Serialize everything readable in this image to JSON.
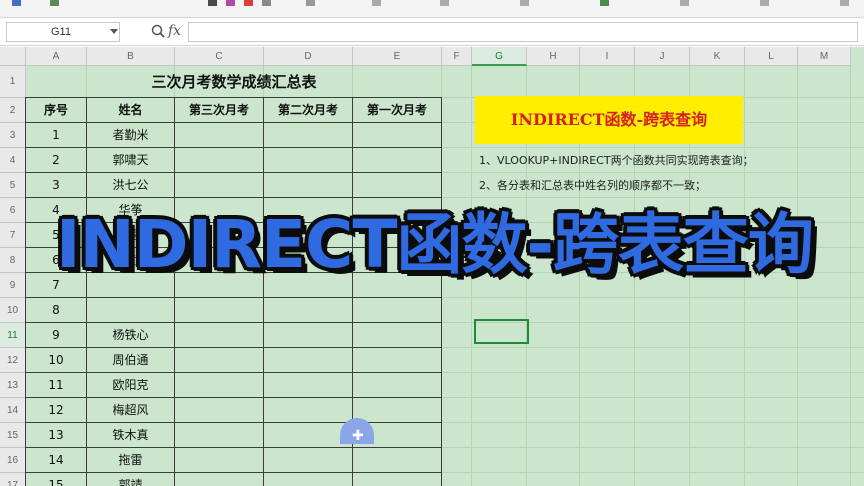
{
  "formula_bar": {
    "name_box": "G11",
    "fx_label": "fx",
    "formula": ""
  },
  "columns": [
    "A",
    "B",
    "C",
    "D",
    "E",
    "F",
    "G",
    "H",
    "I",
    "J",
    "K",
    "L",
    "M"
  ],
  "rows": [
    "1",
    "2",
    "3",
    "4",
    "5",
    "6",
    "7",
    "8",
    "9",
    "10",
    "11",
    "12",
    "13",
    "14",
    "15",
    "16",
    "17"
  ],
  "selected_column": "G",
  "selected_row": "11",
  "table": {
    "title": "三次月考数学成绩汇总表",
    "headers": [
      "序号",
      "姓名",
      "第三次月考",
      "第二次月考",
      "第一次月考"
    ],
    "rows": [
      {
        "no": "1",
        "name": "者勤米"
      },
      {
        "no": "2",
        "name": "郭啸天"
      },
      {
        "no": "3",
        "name": "洪七公"
      },
      {
        "no": "4",
        "name": "华筝"
      },
      {
        "no": "5",
        "name": "黄蓉"
      },
      {
        "no": "6",
        "name": "黄"
      },
      {
        "no": "7",
        "name": ""
      },
      {
        "no": "8",
        "name": ""
      },
      {
        "no": "9",
        "name": "杨铁心"
      },
      {
        "no": "10",
        "name": "周伯通"
      },
      {
        "no": "11",
        "name": "欧阳克"
      },
      {
        "no": "12",
        "name": "梅超风"
      },
      {
        "no": "13",
        "name": "铁木真"
      },
      {
        "no": "14",
        "name": "拖雷"
      },
      {
        "no": "15",
        "name": "郭靖"
      }
    ]
  },
  "topic_box": "INDIRECT函数-跨表查询",
  "notes": [
    "1、VLOOKUP+INDIRECT两个函数共同实现跨表查询；",
    "2、各分表和汇总表中姓名列的顺序都不一致；"
  ],
  "overlay_title": "INDIRECT函数-跨表查询",
  "colors": {
    "sheet_bg": "#cbe6cd",
    "topic_bg": "#ffee00",
    "topic_text": "#d61f1f",
    "overlay_fill": "#2f6ae0",
    "active_cell": "#1f8a3c"
  },
  "icons": {
    "zoom": "zoom-icon",
    "fx": "fx-icon",
    "drag": "fill-handle-plus-icon"
  }
}
